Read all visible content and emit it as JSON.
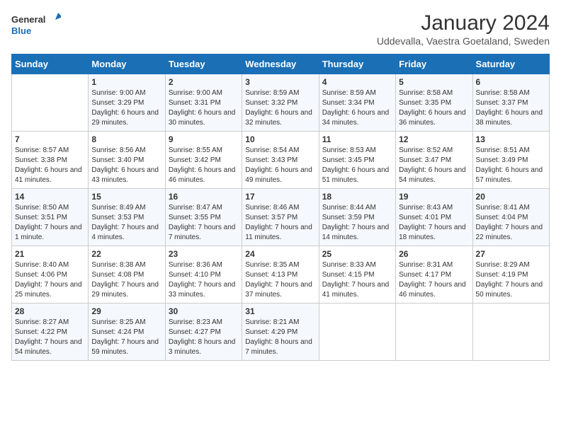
{
  "header": {
    "logo_general": "General",
    "logo_blue": "Blue",
    "month_title": "January 2024",
    "location": "Uddevalla, Vaestra Goetaland, Sweden"
  },
  "days_of_week": [
    "Sunday",
    "Monday",
    "Tuesday",
    "Wednesday",
    "Thursday",
    "Friday",
    "Saturday"
  ],
  "weeks": [
    [
      {
        "day": "",
        "sunrise": "",
        "sunset": "",
        "daylight": ""
      },
      {
        "day": "1",
        "sunrise": "Sunrise: 9:00 AM",
        "sunset": "Sunset: 3:29 PM",
        "daylight": "Daylight: 6 hours and 29 minutes."
      },
      {
        "day": "2",
        "sunrise": "Sunrise: 9:00 AM",
        "sunset": "Sunset: 3:31 PM",
        "daylight": "Daylight: 6 hours and 30 minutes."
      },
      {
        "day": "3",
        "sunrise": "Sunrise: 8:59 AM",
        "sunset": "Sunset: 3:32 PM",
        "daylight": "Daylight: 6 hours and 32 minutes."
      },
      {
        "day": "4",
        "sunrise": "Sunrise: 8:59 AM",
        "sunset": "Sunset: 3:34 PM",
        "daylight": "Daylight: 6 hours and 34 minutes."
      },
      {
        "day": "5",
        "sunrise": "Sunrise: 8:58 AM",
        "sunset": "Sunset: 3:35 PM",
        "daylight": "Daylight: 6 hours and 36 minutes."
      },
      {
        "day": "6",
        "sunrise": "Sunrise: 8:58 AM",
        "sunset": "Sunset: 3:37 PM",
        "daylight": "Daylight: 6 hours and 38 minutes."
      }
    ],
    [
      {
        "day": "7",
        "sunrise": "Sunrise: 8:57 AM",
        "sunset": "Sunset: 3:38 PM",
        "daylight": "Daylight: 6 hours and 41 minutes."
      },
      {
        "day": "8",
        "sunrise": "Sunrise: 8:56 AM",
        "sunset": "Sunset: 3:40 PM",
        "daylight": "Daylight: 6 hours and 43 minutes."
      },
      {
        "day": "9",
        "sunrise": "Sunrise: 8:55 AM",
        "sunset": "Sunset: 3:42 PM",
        "daylight": "Daylight: 6 hours and 46 minutes."
      },
      {
        "day": "10",
        "sunrise": "Sunrise: 8:54 AM",
        "sunset": "Sunset: 3:43 PM",
        "daylight": "Daylight: 6 hours and 49 minutes."
      },
      {
        "day": "11",
        "sunrise": "Sunrise: 8:53 AM",
        "sunset": "Sunset: 3:45 PM",
        "daylight": "Daylight: 6 hours and 51 minutes."
      },
      {
        "day": "12",
        "sunrise": "Sunrise: 8:52 AM",
        "sunset": "Sunset: 3:47 PM",
        "daylight": "Daylight: 6 hours and 54 minutes."
      },
      {
        "day": "13",
        "sunrise": "Sunrise: 8:51 AM",
        "sunset": "Sunset: 3:49 PM",
        "daylight": "Daylight: 6 hours and 57 minutes."
      }
    ],
    [
      {
        "day": "14",
        "sunrise": "Sunrise: 8:50 AM",
        "sunset": "Sunset: 3:51 PM",
        "daylight": "Daylight: 7 hours and 1 minute."
      },
      {
        "day": "15",
        "sunrise": "Sunrise: 8:49 AM",
        "sunset": "Sunset: 3:53 PM",
        "daylight": "Daylight: 7 hours and 4 minutes."
      },
      {
        "day": "16",
        "sunrise": "Sunrise: 8:47 AM",
        "sunset": "Sunset: 3:55 PM",
        "daylight": "Daylight: 7 hours and 7 minutes."
      },
      {
        "day": "17",
        "sunrise": "Sunrise: 8:46 AM",
        "sunset": "Sunset: 3:57 PM",
        "daylight": "Daylight: 7 hours and 11 minutes."
      },
      {
        "day": "18",
        "sunrise": "Sunrise: 8:44 AM",
        "sunset": "Sunset: 3:59 PM",
        "daylight": "Daylight: 7 hours and 14 minutes."
      },
      {
        "day": "19",
        "sunrise": "Sunrise: 8:43 AM",
        "sunset": "Sunset: 4:01 PM",
        "daylight": "Daylight: 7 hours and 18 minutes."
      },
      {
        "day": "20",
        "sunrise": "Sunrise: 8:41 AM",
        "sunset": "Sunset: 4:04 PM",
        "daylight": "Daylight: 7 hours and 22 minutes."
      }
    ],
    [
      {
        "day": "21",
        "sunrise": "Sunrise: 8:40 AM",
        "sunset": "Sunset: 4:06 PM",
        "daylight": "Daylight: 7 hours and 25 minutes."
      },
      {
        "day": "22",
        "sunrise": "Sunrise: 8:38 AM",
        "sunset": "Sunset: 4:08 PM",
        "daylight": "Daylight: 7 hours and 29 minutes."
      },
      {
        "day": "23",
        "sunrise": "Sunrise: 8:36 AM",
        "sunset": "Sunset: 4:10 PM",
        "daylight": "Daylight: 7 hours and 33 minutes."
      },
      {
        "day": "24",
        "sunrise": "Sunrise: 8:35 AM",
        "sunset": "Sunset: 4:13 PM",
        "daylight": "Daylight: 7 hours and 37 minutes."
      },
      {
        "day": "25",
        "sunrise": "Sunrise: 8:33 AM",
        "sunset": "Sunset: 4:15 PM",
        "daylight": "Daylight: 7 hours and 41 minutes."
      },
      {
        "day": "26",
        "sunrise": "Sunrise: 8:31 AM",
        "sunset": "Sunset: 4:17 PM",
        "daylight": "Daylight: 7 hours and 46 minutes."
      },
      {
        "day": "27",
        "sunrise": "Sunrise: 8:29 AM",
        "sunset": "Sunset: 4:19 PM",
        "daylight": "Daylight: 7 hours and 50 minutes."
      }
    ],
    [
      {
        "day": "28",
        "sunrise": "Sunrise: 8:27 AM",
        "sunset": "Sunset: 4:22 PM",
        "daylight": "Daylight: 7 hours and 54 minutes."
      },
      {
        "day": "29",
        "sunrise": "Sunrise: 8:25 AM",
        "sunset": "Sunset: 4:24 PM",
        "daylight": "Daylight: 7 hours and 59 minutes."
      },
      {
        "day": "30",
        "sunrise": "Sunrise: 8:23 AM",
        "sunset": "Sunset: 4:27 PM",
        "daylight": "Daylight: 8 hours and 3 minutes."
      },
      {
        "day": "31",
        "sunrise": "Sunrise: 8:21 AM",
        "sunset": "Sunset: 4:29 PM",
        "daylight": "Daylight: 8 hours and 7 minutes."
      },
      {
        "day": "",
        "sunrise": "",
        "sunset": "",
        "daylight": ""
      },
      {
        "day": "",
        "sunrise": "",
        "sunset": "",
        "daylight": ""
      },
      {
        "day": "",
        "sunrise": "",
        "sunset": "",
        "daylight": ""
      }
    ]
  ]
}
